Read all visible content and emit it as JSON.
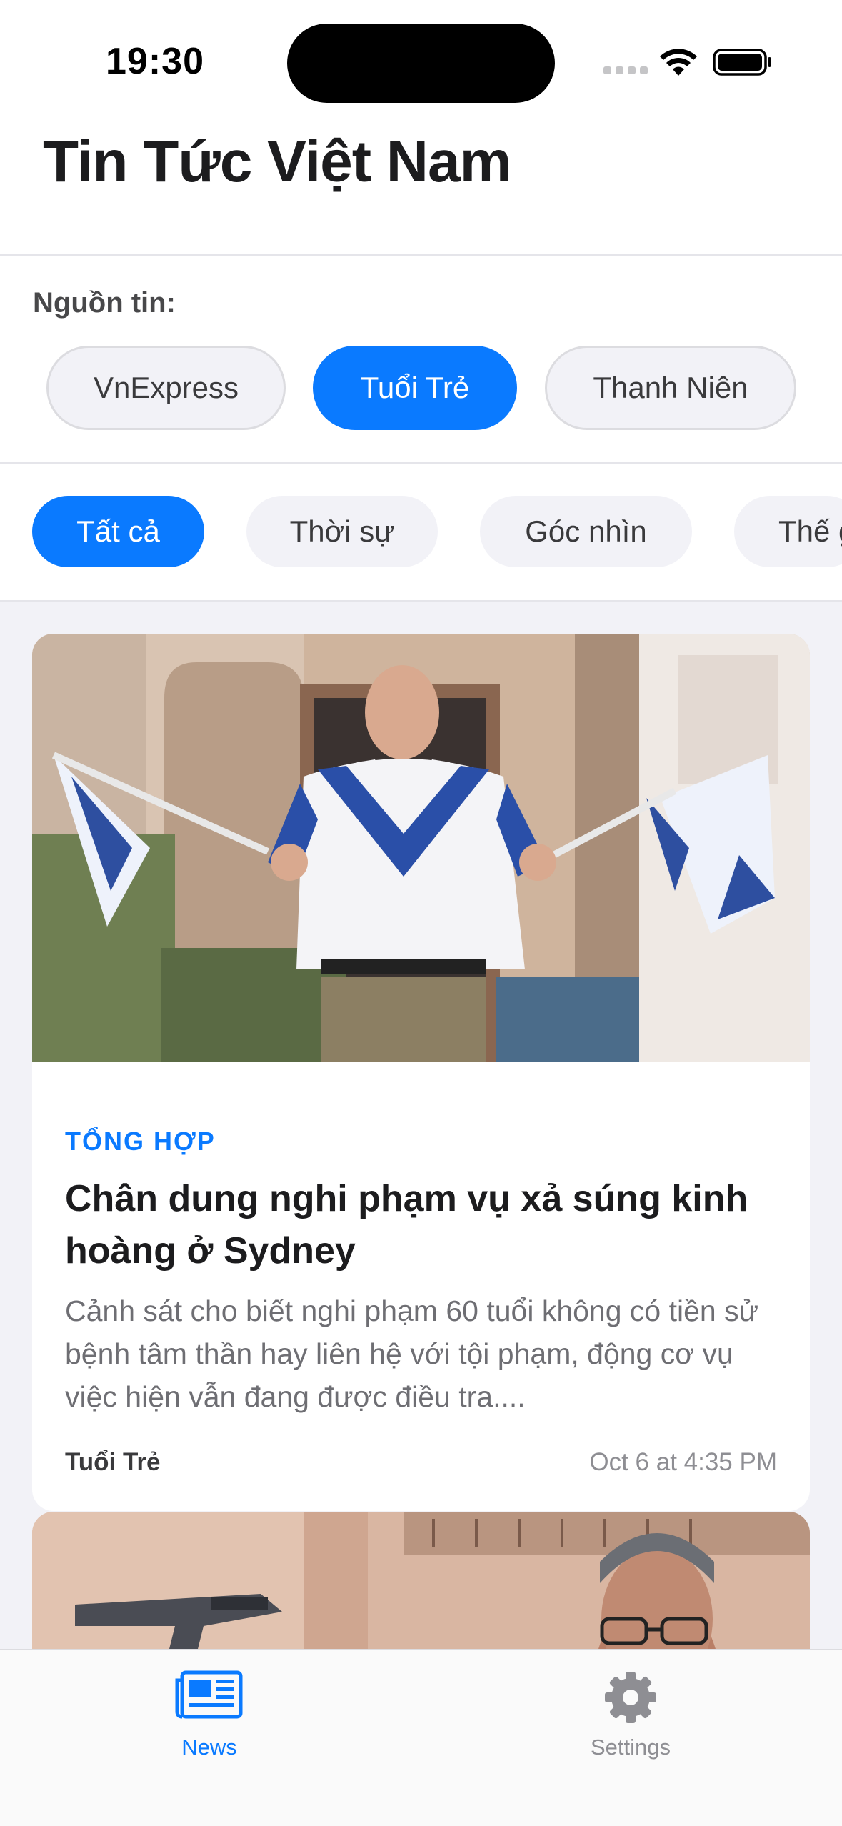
{
  "status_bar": {
    "time": "19:30"
  },
  "header": {
    "title": "Tin Tức Việt Nam"
  },
  "sources": {
    "label": "Nguồn tin:",
    "items": [
      "VnExpress",
      "Tuổi Trẻ",
      "Thanh Niên"
    ],
    "selected": "Tuổi Trẻ"
  },
  "categories": {
    "items": [
      "Tất cả",
      "Thời sự",
      "Góc nhìn",
      "Thế giới"
    ],
    "selected": "Tất cả"
  },
  "articles": [
    {
      "category": "TỔNG HỢP",
      "title": "Chân dung nghi phạm vụ xả súng kinh hoàng ở Sydney",
      "summary": "Cảnh sát cho biết nghi phạm 60 tuổi không có tiền sử bệnh tâm thần hay liên hệ với tội phạm, động cơ vụ việc hiện vẫn đang được điều tra....",
      "source": "Tuổi Trẻ",
      "time": "Oct 6 at 4:35 PM"
    }
  ],
  "tab_bar": {
    "items": [
      {
        "label": "News",
        "icon": "newspaper-icon",
        "active": true
      },
      {
        "label": "Settings",
        "icon": "gear-icon",
        "active": false
      }
    ]
  },
  "colors": {
    "accent": "#0A7AFF",
    "tab_inactive": "#8E8E93",
    "feed_background": "#F2F2F7"
  }
}
